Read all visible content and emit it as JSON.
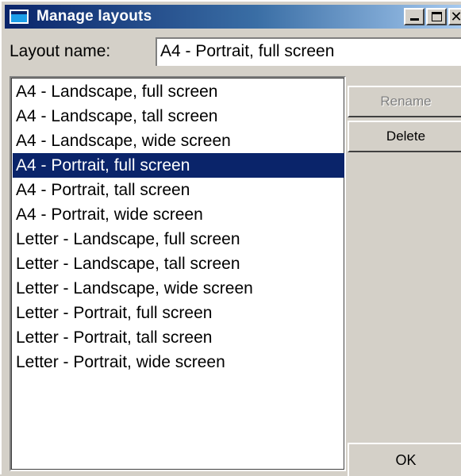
{
  "window": {
    "title": "Manage layouts"
  },
  "layout_name": {
    "label": "Layout name:",
    "value": "A4 - Portrait, full screen"
  },
  "layouts": {
    "selected_index": 3,
    "items": [
      "A4 - Landscape, full screen",
      "A4 - Landscape, tall screen",
      "A4 - Landscape, wide screen",
      "A4 - Portrait, full screen",
      "A4 - Portrait, tall screen",
      "A4 - Portrait, wide screen",
      "Letter - Landscape, full screen",
      "Letter - Landscape, tall screen",
      "Letter - Landscape, wide screen",
      "Letter - Portrait, full screen",
      "Letter - Portrait, tall screen",
      "Letter - Portrait, wide screen"
    ]
  },
  "buttons": {
    "rename": "Rename",
    "delete": "Delete",
    "ok": "OK"
  },
  "colors": {
    "selection": "#0a246a",
    "titlebar_start": "#0a246a",
    "titlebar_end": "#a6caf0",
    "face": "#d4d0c8"
  },
  "icons": {
    "title": "window-icon",
    "minimize": "minimize-icon",
    "maximize": "maximize-icon",
    "close": "close-icon"
  }
}
